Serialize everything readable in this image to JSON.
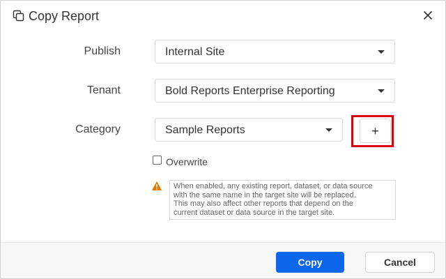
{
  "dialog": {
    "title": "Copy Report",
    "icon": "copy-icon",
    "close_icon": "close-icon"
  },
  "form": {
    "publish": {
      "label": "Publish",
      "value": "Internal Site"
    },
    "tenant": {
      "label": "Tenant",
      "value": "Bold Reports Enterprise Reporting"
    },
    "category": {
      "label": "Category",
      "value": "Sample Reports",
      "add_label": "+"
    },
    "overwrite": {
      "label": "Overwrite",
      "checked": false
    },
    "warning": {
      "icon": "warning-icon",
      "color": "#e07b00",
      "line1": "When enabled, any existing report, dataset, or data source",
      "line2": "with the same name in the target site will be replaced.",
      "line3": "This may also affect other reports that depend on the",
      "line4": "current dataset or data source in the target site."
    }
  },
  "footer": {
    "copy_label": "Copy",
    "cancel_label": "Cancel",
    "primary_color": "#0b66ea"
  },
  "highlight_color": "#e0000f"
}
